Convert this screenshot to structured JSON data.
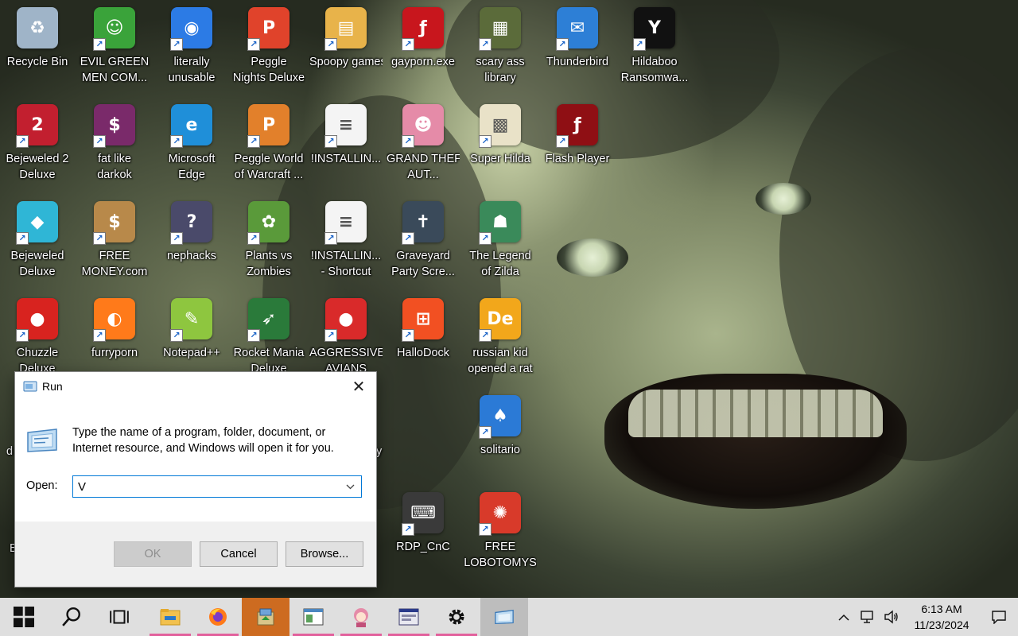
{
  "desktop": {
    "icons": [
      {
        "label": "Recycle Bin",
        "icon": "recycle-bin-icon",
        "color": "#9fb4c8"
      },
      {
        "label": "EVIL GREEN MEN COM...",
        "icon": "green-men-icon",
        "color": "#3aa33a"
      },
      {
        "label": "literally unusable",
        "icon": "chrome-icon",
        "color": "#2c7be5"
      },
      {
        "label": "Peggle Nights Deluxe",
        "icon": "peggle-nights-icon",
        "color": "#e0432b"
      },
      {
        "label": "Spoopy games",
        "icon": "folder-icon",
        "color": "#e8b34a"
      },
      {
        "label": "gayporn.exe",
        "icon": "flash-icon",
        "color": "#c8161d"
      },
      {
        "label": "scary ass library",
        "icon": "library-icon",
        "color": "#5b6b3a"
      },
      {
        "label": "Thunderbird",
        "icon": "thunderbird-icon",
        "color": "#2d7fd6"
      },
      {
        "label": "Hildaboo Ransomwa...",
        "icon": "yashma-icon",
        "color": "#111111"
      },
      {
        "label": "Bejeweled 2 Deluxe",
        "icon": "bejeweled2-icon",
        "color": "#c21f2f"
      },
      {
        "label": "fat like darkok",
        "icon": "vegas-icon",
        "color": "#7a2a6a"
      },
      {
        "label": "Microsoft Edge",
        "icon": "edge-icon",
        "color": "#1f8fd9"
      },
      {
        "label": "Peggle World of Warcraft ...",
        "icon": "peggle-wow-icon",
        "color": "#e2802b"
      },
      {
        "label": "!INSTALLIN...",
        "icon": "text-file-icon",
        "color": "#f4f4f4"
      },
      {
        "label": "GRAND THEFT AUT...",
        "icon": "anime-girl-icon",
        "color": "#e58ba8"
      },
      {
        "label": "Super Hilda",
        "icon": "pixel-hilda-icon",
        "color": "#e9e2c8"
      },
      {
        "label": "Flash Player",
        "icon": "flash-player-icon",
        "color": "#8f0f14"
      },
      {
        "label": "Bejeweled Deluxe",
        "icon": "gem-icon",
        "color": "#2fb6d6"
      },
      {
        "label": "FREE MONEY.com",
        "icon": "money-bag-icon",
        "color": "#b8894a"
      },
      {
        "label": "nephacks",
        "icon": "mystery-icon",
        "color": "#4a4a6a"
      },
      {
        "label": "Plants vs Zombies",
        "icon": "pvz-icon",
        "color": "#5a9a3a"
      },
      {
        "label": "!INSTALLIN... - Shortcut",
        "icon": "text-file-icon",
        "color": "#f4f4f4"
      },
      {
        "label": "Graveyard Party Scre...",
        "icon": "graveyard-icon",
        "color": "#3a4a5a"
      },
      {
        "label": "The Legend of Zilda",
        "icon": "zilda-icon",
        "color": "#3a8a5a"
      },
      {
        "label": "Chuzzle Deluxe",
        "icon": "chuzzle-icon",
        "color": "#d8231f"
      },
      {
        "label": "furryporn",
        "icon": "firefox-icon",
        "color": "#ff7a1a"
      },
      {
        "label": "Notepad++",
        "icon": "notepadpp-icon",
        "color": "#8ec63f"
      },
      {
        "label": "Rocket Mania Deluxe",
        "icon": "rocket-icon",
        "color": "#2a7a3a"
      },
      {
        "label": "AGGRESSIVE AVIANS",
        "icon": "angry-bird-icon",
        "color": "#d92a2a"
      },
      {
        "label": "HalloDock",
        "icon": "windows-logo-icon",
        "color": "#f25022"
      },
      {
        "label": "russian kid opened a rat",
        "icon": "de-icon",
        "color": "#f2a71b"
      },
      {
        "label": "solitario",
        "icon": "solitaire-icon",
        "color": "#2b7ad6"
      },
      {
        "label": "RDP_CnC",
        "icon": "rdp-icon",
        "color": "#3a3a3a"
      },
      {
        "label": "FREE LOBOTOMYS",
        "icon": "lobotomy-icon",
        "color": "#d83a2a"
      }
    ],
    "partial_labels": {
      "left_d": "d",
      "left_e": "E",
      "right_y": "y"
    }
  },
  "run_dialog": {
    "title": "Run",
    "description": "Type the name of a program, folder, document, or Internet resource, and Windows will open it for you.",
    "open_label": "Open:",
    "open_value": "V",
    "buttons": {
      "ok": "OK",
      "cancel": "Cancel",
      "browse": "Browse..."
    }
  },
  "taskbar": {
    "apps": [
      {
        "icon": "windows-start-icon"
      },
      {
        "icon": "search-icon"
      },
      {
        "icon": "task-view-icon"
      },
      {
        "icon": "file-explorer-icon"
      },
      {
        "icon": "firefox-icon"
      },
      {
        "icon": "installer-icon"
      },
      {
        "icon": "window-app-icon"
      },
      {
        "icon": "anime-girl-icon"
      },
      {
        "icon": "program-window-icon"
      },
      {
        "icon": "settings-gear-icon"
      },
      {
        "icon": "run-icon"
      }
    ],
    "tray": {
      "time": "6:13 AM",
      "date": "11/23/2024"
    }
  },
  "colors": {
    "accent": "#0078d7",
    "taskbar_bg": "#dfdfdf",
    "active_app_bg": "#cd6b20",
    "running_indicator": "#e2609c"
  }
}
